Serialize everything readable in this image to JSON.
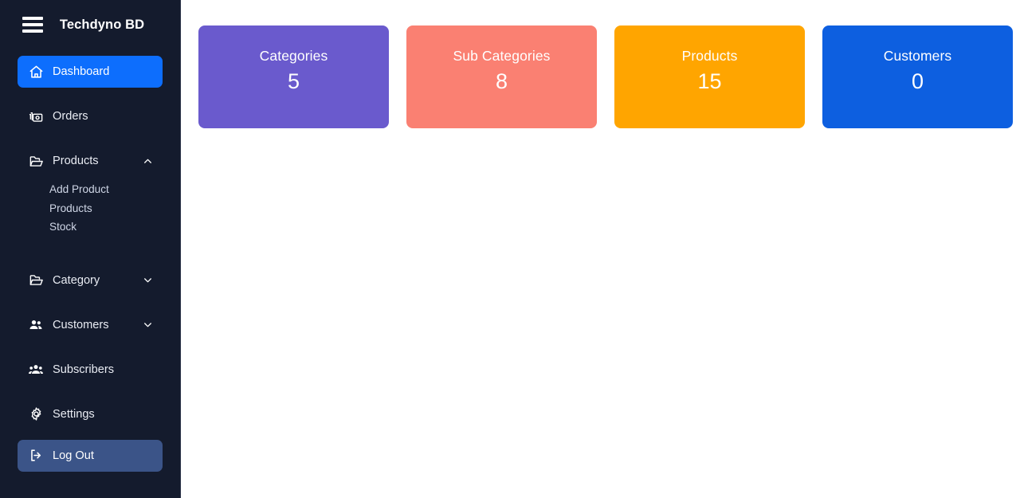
{
  "sidebar": {
    "brand": "Techdyno BD",
    "menu_icon": "hamburger-icon",
    "items": [
      {
        "label": "Dashboard",
        "icon": "home-icon",
        "state": "active"
      },
      {
        "label": "Orders",
        "icon": "orders-icon",
        "state": "default"
      },
      {
        "label": "Products",
        "icon": "folder-icon",
        "state": "expanded",
        "chevron": "chevron-up-icon"
      },
      {
        "label": "Category",
        "icon": "folder-icon",
        "state": "collapsed",
        "chevron": "chevron-down-icon"
      },
      {
        "label": "Customers",
        "icon": "users-icon",
        "state": "collapsed",
        "chevron": "chevron-down-icon"
      },
      {
        "label": "Subscribers",
        "icon": "user-group-icon",
        "state": "default"
      },
      {
        "label": "Settings",
        "icon": "gear-icon",
        "state": "default"
      },
      {
        "label": "Log Out",
        "icon": "sign-out-icon",
        "state": "highlighted"
      }
    ],
    "products_submenu": [
      {
        "label": "Add Product"
      },
      {
        "label": "Products"
      },
      {
        "label": "Stock"
      }
    ]
  },
  "main": {
    "cards": [
      {
        "title": "Categories",
        "value": "5",
        "color": "#6a5acd"
      },
      {
        "title": "Sub Categories",
        "value": "8",
        "color": "#fa8072"
      },
      {
        "title": "Products",
        "value": "15",
        "color": "#ffa500"
      },
      {
        "title": "Customers",
        "value": "0",
        "color": "#0d5fe0"
      }
    ]
  },
  "colors": {
    "sidebar_bg": "#141b2d",
    "active_item": "#0d6efd",
    "logout_item": "#3b5488",
    "content_bg": "#ffffff"
  }
}
